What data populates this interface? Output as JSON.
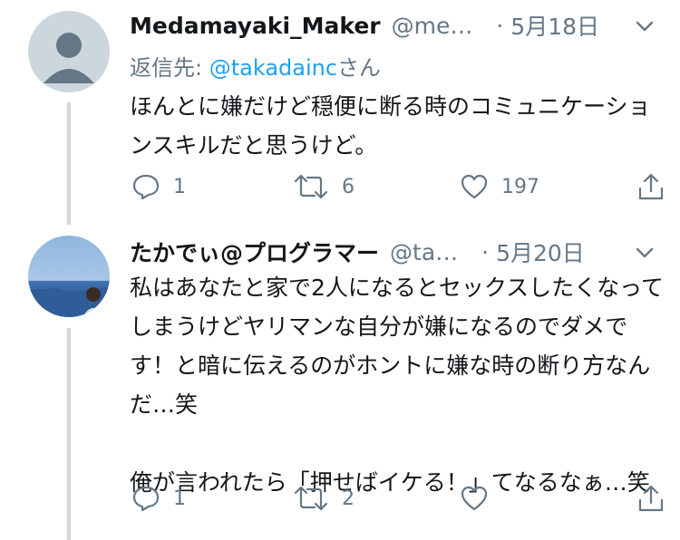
{
  "tweets": [
    {
      "name": "Medamayaki_Maker",
      "handle": "@me…",
      "dot": "·",
      "date": "5月18日",
      "reply_prefix": "返信先: ",
      "reply_mention": "@takadainc",
      "reply_suffix": "さん",
      "text": "ほんとに嫌だけど穏便に断る時のコミュニケーションスキルだと思うけど。",
      "reply_count": "1",
      "retweet_count": "6",
      "like_count": "197"
    },
    {
      "name": "たかでぃ@プログラマー",
      "handle": "@ta…",
      "dot": "·",
      "date": "5月20日",
      "text": "私はあなたと家で2人になるとセックスしたくなってしまうけどヤリマンな自分が嫌になるのでダメです！と暗に伝えるのがホントに嫌な時の断り方なんだ…笑\n\n俺が言われたら「押せばイケる！」てなるなぁ…笑",
      "reply_count": "1",
      "retweet_count": "2",
      "like_count": ""
    }
  ],
  "colors": {
    "text": "#14171a",
    "secondary": "#657786",
    "link": "#1da1f2",
    "thread_line": "#cfd9de"
  }
}
